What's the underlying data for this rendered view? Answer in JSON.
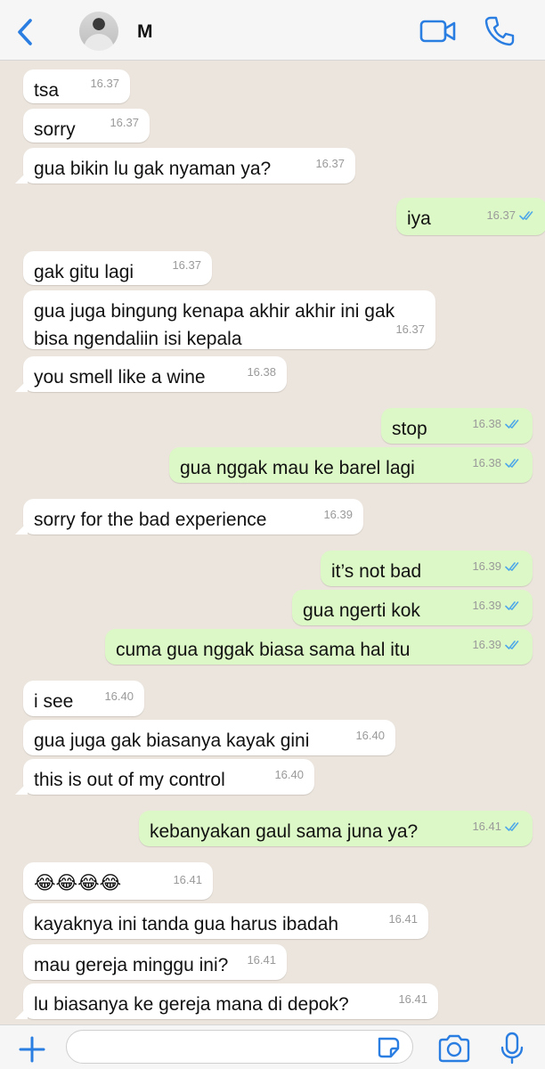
{
  "header": {
    "contact_name": "M",
    "icons": {
      "back": "chevron-left-icon",
      "video": "video-call-icon",
      "phone": "phone-icon",
      "avatar": "profile-photo"
    }
  },
  "colors": {
    "accent": "#2a7de1",
    "incoming_bubble": "#ffffff",
    "outgoing_bubble": "#dcf8c6",
    "chat_background": "#ece5dd",
    "read_ticks": "#4fa8e8"
  },
  "messages": [
    {
      "side": "in",
      "text": "tsa",
      "time": "16.37"
    },
    {
      "side": "in",
      "text": "sorry",
      "time": "16.37"
    },
    {
      "side": "in",
      "text": "gua bikin lu gak nyaman ya?",
      "time": "16.37"
    },
    {
      "side": "out",
      "text": "iya",
      "time": "16.37",
      "read": true
    },
    {
      "side": "in",
      "text": "gak gitu lagi",
      "time": "16.37"
    },
    {
      "side": "in",
      "text": "gua juga bingung kenapa akhir akhir ini gak\nbisa ngendaliin isi kepala",
      "time": "16.37"
    },
    {
      "side": "in",
      "text": "you smell like a wine",
      "time": "16.38"
    },
    {
      "side": "out",
      "text": "stop",
      "time": "16.38",
      "read": true
    },
    {
      "side": "out",
      "text": "gua nggak mau ke barel lagi",
      "time": "16.38",
      "read": true
    },
    {
      "side": "in",
      "text": "sorry for the bad experience",
      "time": "16.39"
    },
    {
      "side": "out",
      "text": "it’s not bad",
      "time": "16.39",
      "read": true
    },
    {
      "side": "out",
      "text": "gua ngerti kok",
      "time": "16.39",
      "read": true
    },
    {
      "side": "out",
      "text": "cuma gua nggak biasa sama hal itu",
      "time": "16.39",
      "read": true
    },
    {
      "side": "in",
      "text": "i see",
      "time": "16.40"
    },
    {
      "side": "in",
      "text": "gua juga gak biasanya kayak gini",
      "time": "16.40"
    },
    {
      "side": "in",
      "text": "this is out of my control",
      "time": "16.40"
    },
    {
      "side": "out",
      "text": "kebanyakan gaul sama juna ya?",
      "time": "16.41",
      "read": true
    },
    {
      "side": "in",
      "text": "😂😂😂😂",
      "time": "16.41"
    },
    {
      "side": "in",
      "text": "kayaknya ini tanda gua harus ibadah",
      "time": "16.41"
    },
    {
      "side": "in",
      "text": "mau gereja minggu ini?",
      "time": "16.41"
    },
    {
      "side": "in",
      "text": "lu biasanya ke gereja mana di depok?",
      "time": "16.41"
    }
  ],
  "footer": {
    "input_value": "",
    "icons": {
      "plus": "plus-icon",
      "sticker": "sticker-icon",
      "camera": "camera-icon",
      "mic": "microphone-icon"
    }
  }
}
